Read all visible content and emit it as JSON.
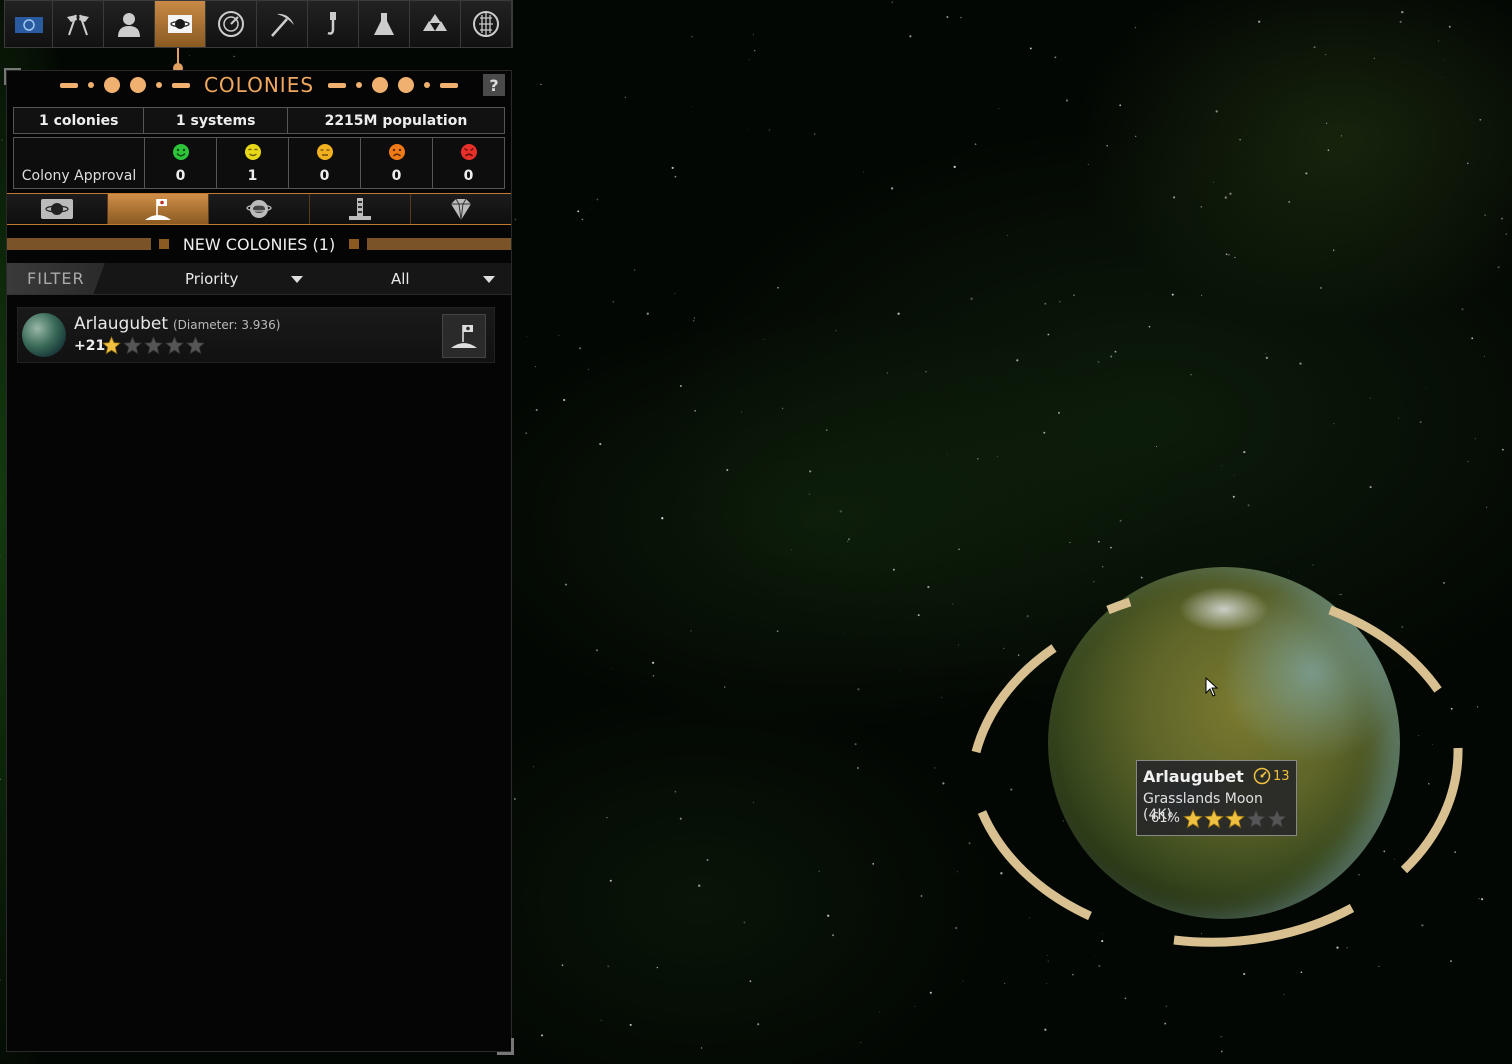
{
  "toolbar": {
    "items": [
      {
        "id": "empire",
        "icon": "empire-flag-icon"
      },
      {
        "id": "diplomacy",
        "icon": "crossed-flags-icon"
      },
      {
        "id": "characters",
        "icon": "person-icon"
      },
      {
        "id": "colonies",
        "icon": "colony-planet-icon",
        "active": true
      },
      {
        "id": "research",
        "icon": "gauge-icon"
      },
      {
        "id": "mining",
        "icon": "pickaxe-icon"
      },
      {
        "id": "construction",
        "icon": "crane-hook-icon"
      },
      {
        "id": "science",
        "icon": "flask-icon"
      },
      {
        "id": "fleets",
        "icon": "ships-icon"
      },
      {
        "id": "galaxy",
        "icon": "grid-globe-icon"
      }
    ]
  },
  "panel": {
    "title": "COLONIES",
    "help_label": "?",
    "stats": {
      "colonies": "1 colonies",
      "systems": "1 systems",
      "population": "2215M population"
    },
    "approval": {
      "label": "Colony Approval",
      "levels": [
        {
          "mood": "ecstatic",
          "color": "#2ec43a",
          "count": "0"
        },
        {
          "mood": "happy",
          "color": "#e8d81a",
          "count": "1"
        },
        {
          "mood": "content",
          "color": "#f0b020",
          "count": "0"
        },
        {
          "mood": "unhappy",
          "color": "#f07a18",
          "count": "0"
        },
        {
          "mood": "angry",
          "color": "#e8302a",
          "count": "0"
        }
      ]
    },
    "subtabs": [
      {
        "icon": "planet-icon",
        "active": false
      },
      {
        "icon": "colonize-flag-icon",
        "active": true
      },
      {
        "icon": "orbit-planet-icon",
        "active": false
      },
      {
        "icon": "tower-icon",
        "active": false
      },
      {
        "icon": "diamond-icon",
        "active": false
      }
    ],
    "section_title": "NEW COLONIES (1)",
    "filter": {
      "label": "FILTER",
      "sort_value": "Priority",
      "type_value": "All"
    },
    "colonies": [
      {
        "name": "Arlaugubet",
        "diameter": "(Diameter: 3.936)",
        "score": "+21",
        "rating": 1,
        "max_rating": 5
      }
    ]
  },
  "map": {
    "planet_tooltip": {
      "name": "Arlaugubet",
      "population": "13",
      "type": "Grasslands Moon (4K)",
      "quality": "61%",
      "rating": 3,
      "max_rating": 5
    }
  }
}
